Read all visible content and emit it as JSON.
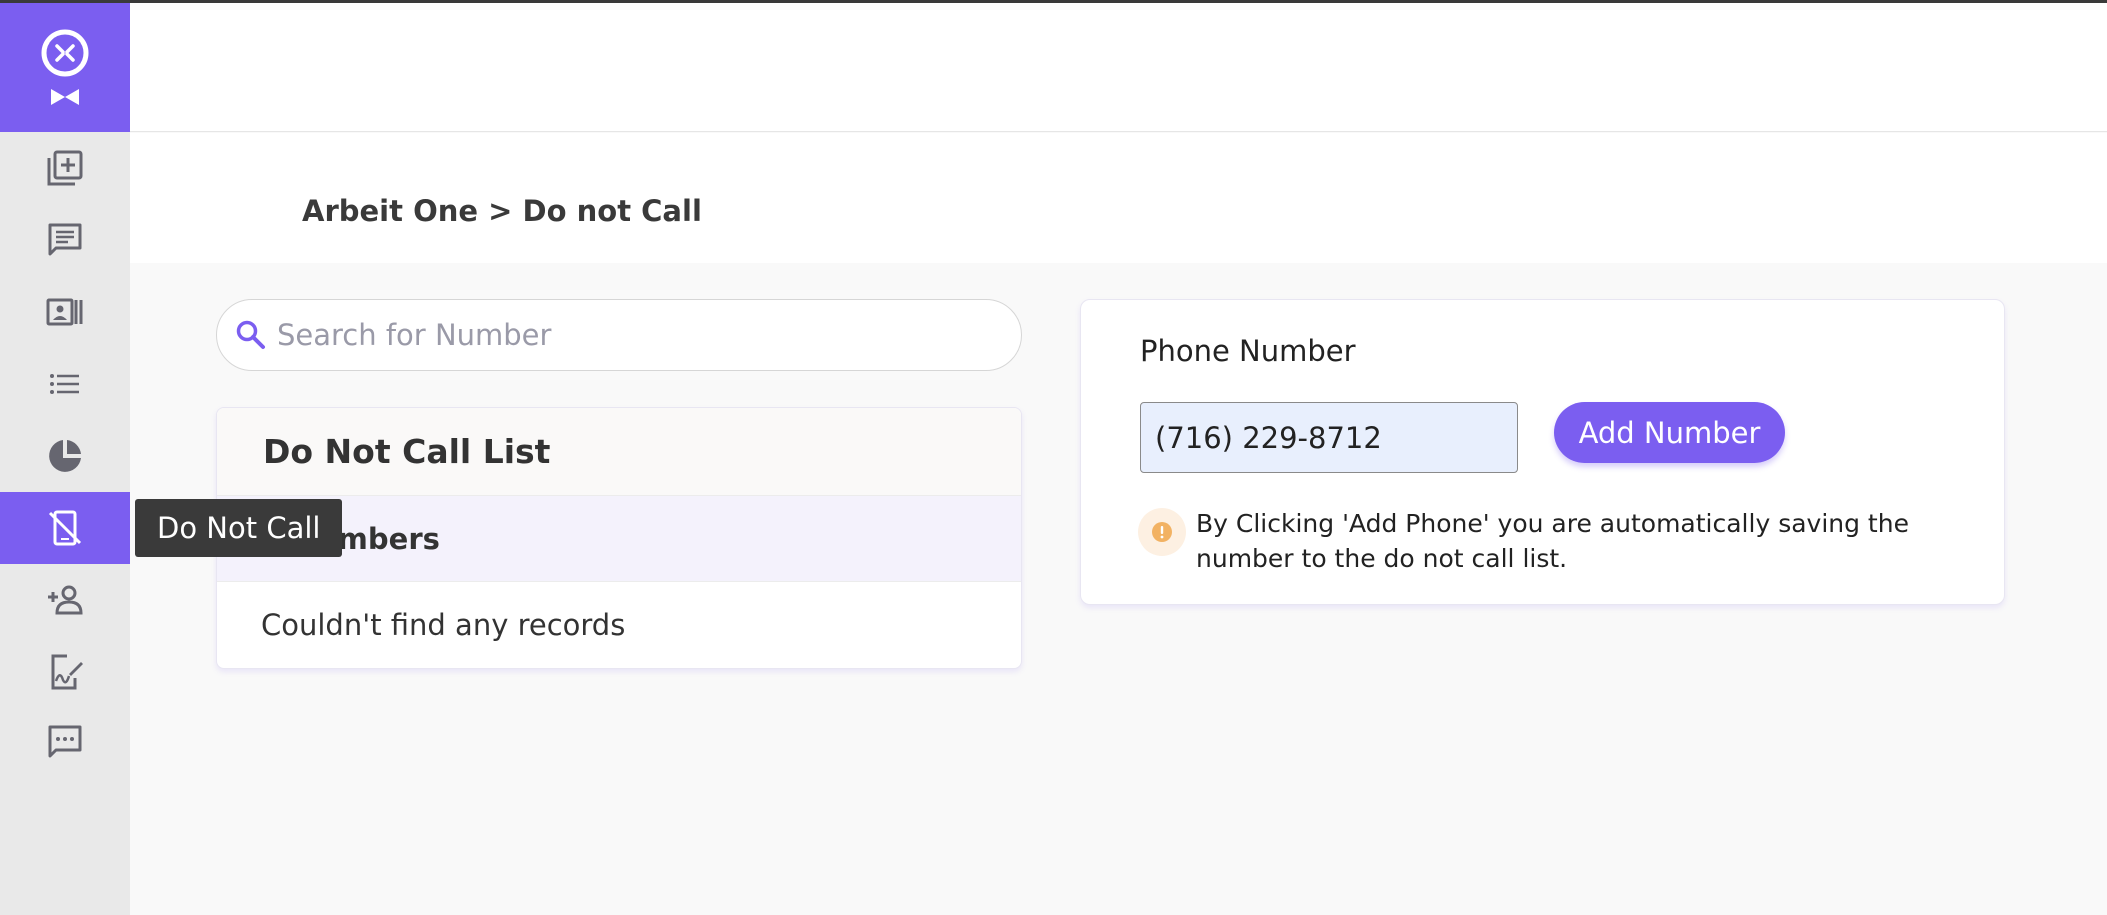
{
  "breadcrumb": "Arbeit One > Do not Call",
  "sidebar": {
    "items": [
      {
        "icon": "add-library-icon",
        "active": false
      },
      {
        "icon": "chat-icon",
        "active": false
      },
      {
        "icon": "contact-card-icon",
        "active": false
      },
      {
        "icon": "list-icon",
        "active": false
      },
      {
        "icon": "pie-chart-icon",
        "active": false
      },
      {
        "icon": "phone-off-icon",
        "active": true
      },
      {
        "icon": "add-person-icon",
        "active": false
      },
      {
        "icon": "signature-icon",
        "active": false
      },
      {
        "icon": "comment-dots-icon",
        "active": false
      }
    ],
    "tooltip": "Do Not Call"
  },
  "search": {
    "placeholder": "Search for Number"
  },
  "list": {
    "title": "Do Not Call List",
    "subheader_visible": "e Numbers",
    "empty_text": "Couldn't find any records"
  },
  "form": {
    "label": "Phone Number",
    "phone_value": "(716) 229-8712",
    "button_label": "Add Number",
    "notice": "By Clicking 'Add Phone' you are automatically saving the number to the do not call list."
  },
  "colors": {
    "accent": "#7b5ef0",
    "sidebar_bg": "#e9e9e9",
    "icon": "#666670",
    "notice_icon": "#f2b263"
  }
}
